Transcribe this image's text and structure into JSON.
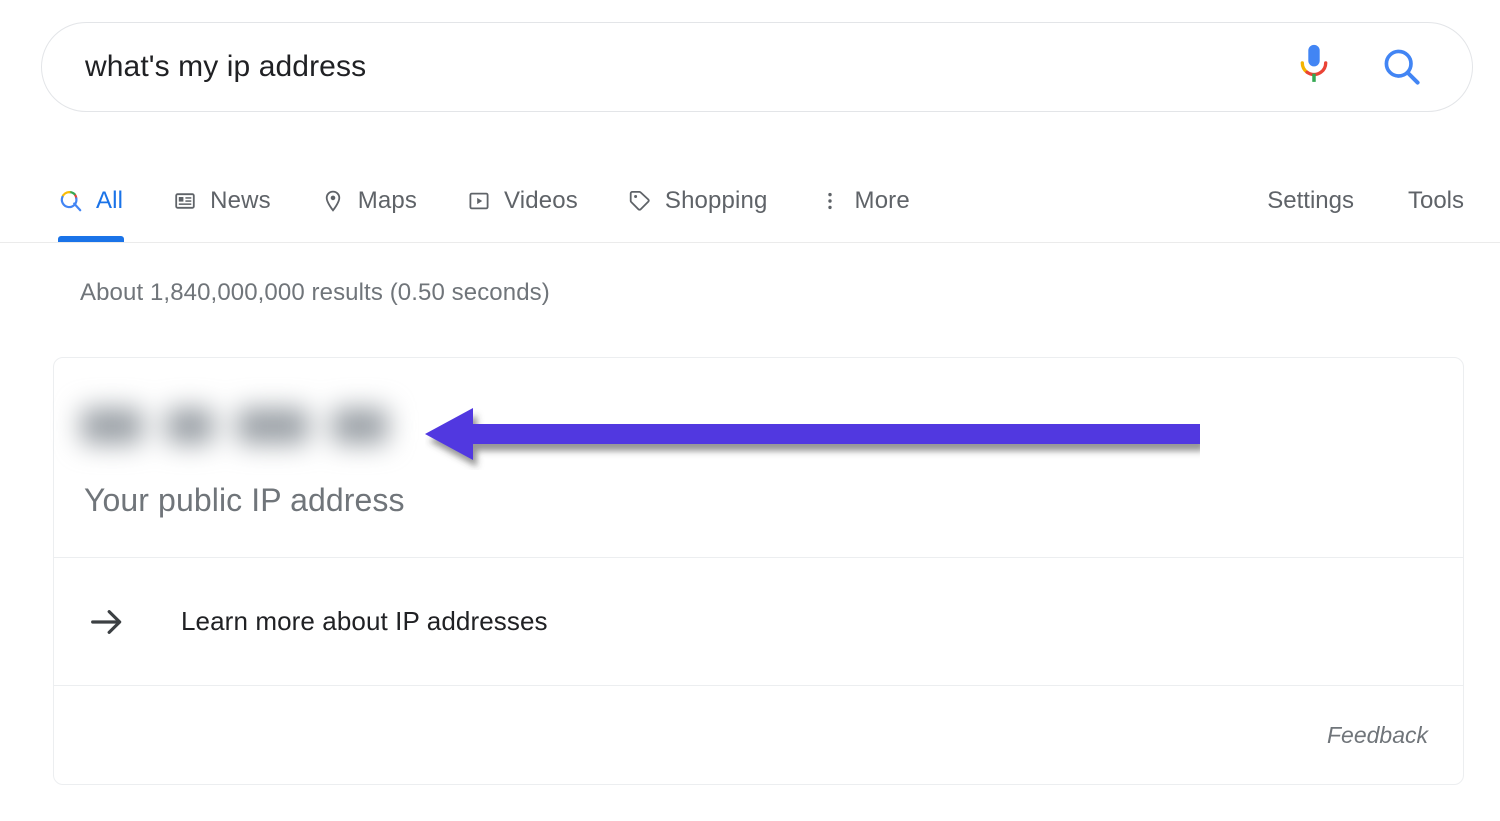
{
  "search": {
    "query": "what's my ip address",
    "placeholder": "Search",
    "mic_icon": "microphone-icon",
    "submit_icon": "search-icon"
  },
  "nav": {
    "tabs": [
      {
        "label": "All",
        "icon": "search-icon",
        "active": true
      },
      {
        "label": "News",
        "icon": "news-icon",
        "active": false
      },
      {
        "label": "Maps",
        "icon": "map-pin-icon",
        "active": false
      },
      {
        "label": "Videos",
        "icon": "video-play-icon",
        "active": false
      },
      {
        "label": "Shopping",
        "icon": "price-tag-icon",
        "active": false
      },
      {
        "label": "More",
        "icon": "more-vertical-icon",
        "active": false
      }
    ],
    "links": [
      {
        "label": "Settings"
      },
      {
        "label": "Tools"
      }
    ]
  },
  "results": {
    "stats": "About 1,840,000,000 results (0.50 seconds)"
  },
  "answer_card": {
    "ip_value_redacted": true,
    "ip_caption": "Your public IP address",
    "learn_more": {
      "label": "Learn more about IP addresses",
      "icon": "arrow-right-icon"
    },
    "feedback_label": "Feedback"
  },
  "annotation": {
    "type": "arrow-left",
    "color": "#5139e0",
    "target": "redacted IP address value"
  },
  "colors": {
    "accent_blue": "#1a73e8",
    "text_primary": "#202124",
    "text_secondary": "#70757a",
    "border": "#eceef0",
    "annotation_purple": "#5139e0"
  }
}
